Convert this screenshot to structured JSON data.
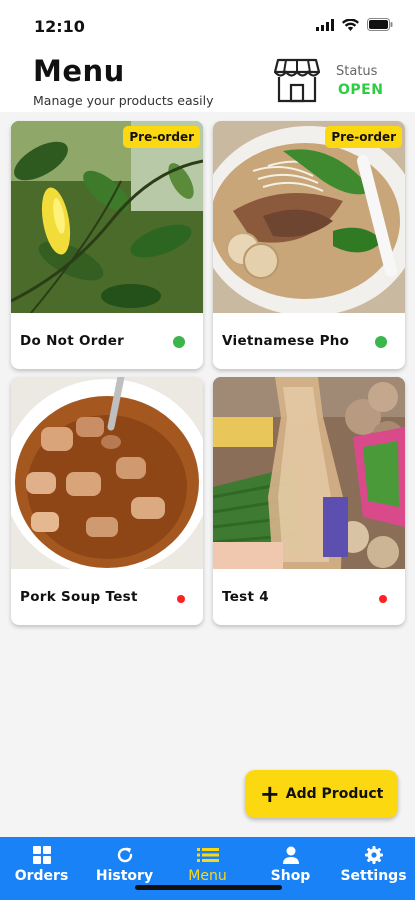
{
  "status_bar": {
    "time": "12:10"
  },
  "header": {
    "title": "Menu",
    "subtitle": "Manage your products easily",
    "status_label": "Status",
    "status_value": "OPEN"
  },
  "products": [
    {
      "name": "Do Not Order",
      "badge": "Pre-order",
      "status": "available",
      "dot_color": "#3cb54a"
    },
    {
      "name": "Vietnamese Pho",
      "badge": "Pre-order",
      "status": "available",
      "dot_color": "#3cb54a"
    },
    {
      "name": "Pork Soup Test",
      "badge": "",
      "status": "unavailable",
      "dot_color": "#ff2020"
    },
    {
      "name": "Test 4",
      "badge": "",
      "status": "unavailable",
      "dot_color": "#ff2020"
    }
  ],
  "add_button": {
    "icon": "plus-icon",
    "label": "Add Product"
  },
  "tabs": [
    {
      "label": "Orders",
      "icon": "grid-icon"
    },
    {
      "label": "History",
      "icon": "refresh-icon"
    },
    {
      "label": "Menu",
      "icon": "list-icon",
      "active": true
    },
    {
      "label": "Shop",
      "icon": "person-icon"
    },
    {
      "label": "Settings",
      "icon": "gear-icon"
    }
  ],
  "colors": {
    "accent": "#fcd811",
    "tabbar": "#1a82f7",
    "open": "#2ecc40"
  }
}
